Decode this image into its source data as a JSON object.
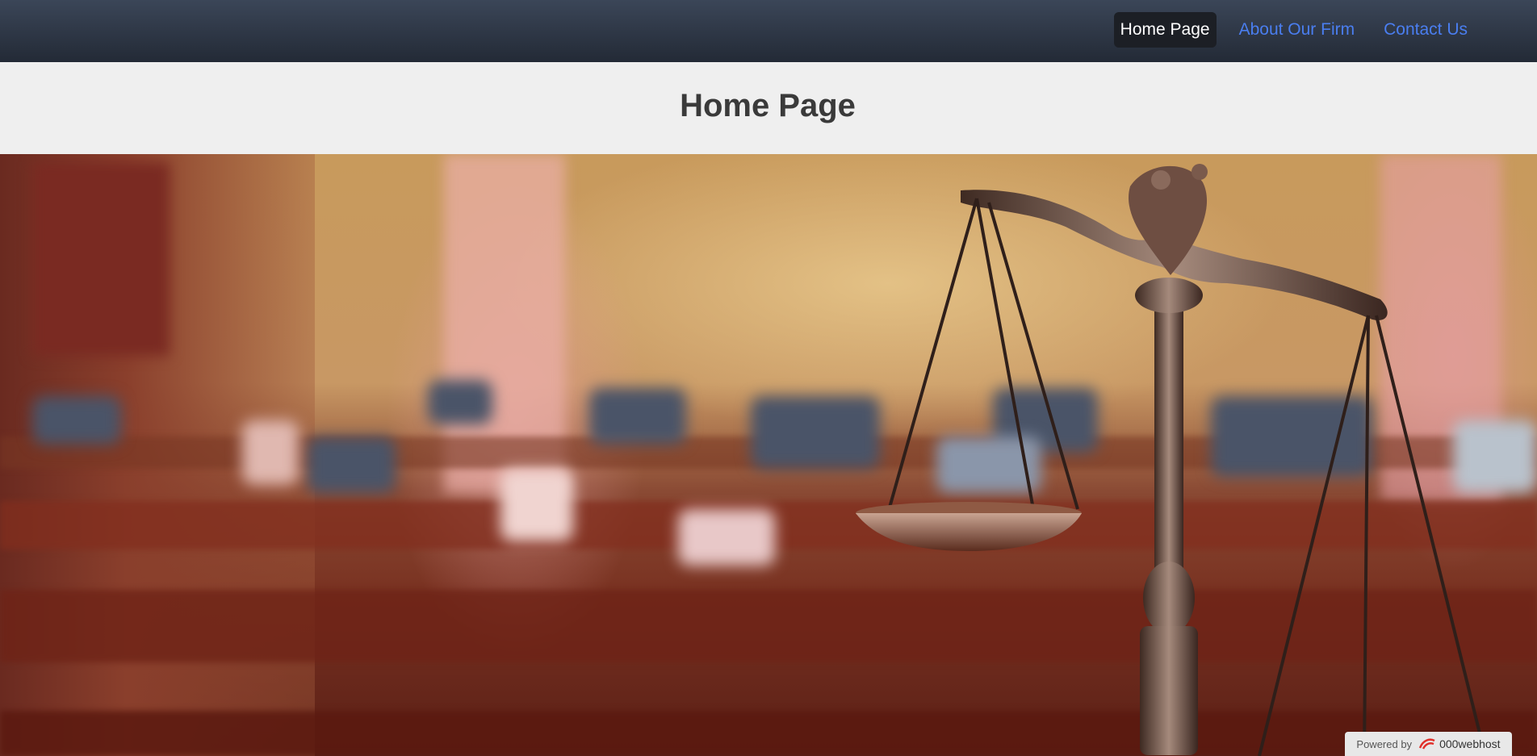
{
  "nav": {
    "links": [
      {
        "label": "Home Page",
        "active": true
      },
      {
        "label": "About Our Firm",
        "active": false
      },
      {
        "label": "Contact Us",
        "active": false
      }
    ]
  },
  "header": {
    "title": "Home Page"
  },
  "hero": {
    "image": "courtroom-scales-of-justice"
  },
  "badge": {
    "prefix": "Powered by",
    "brand": "000webhost"
  },
  "colors": {
    "nav_bg": "#2b3340",
    "link": "#4a7ef0",
    "active_bg": "#1c1f25",
    "header_bg": "#efefef"
  }
}
